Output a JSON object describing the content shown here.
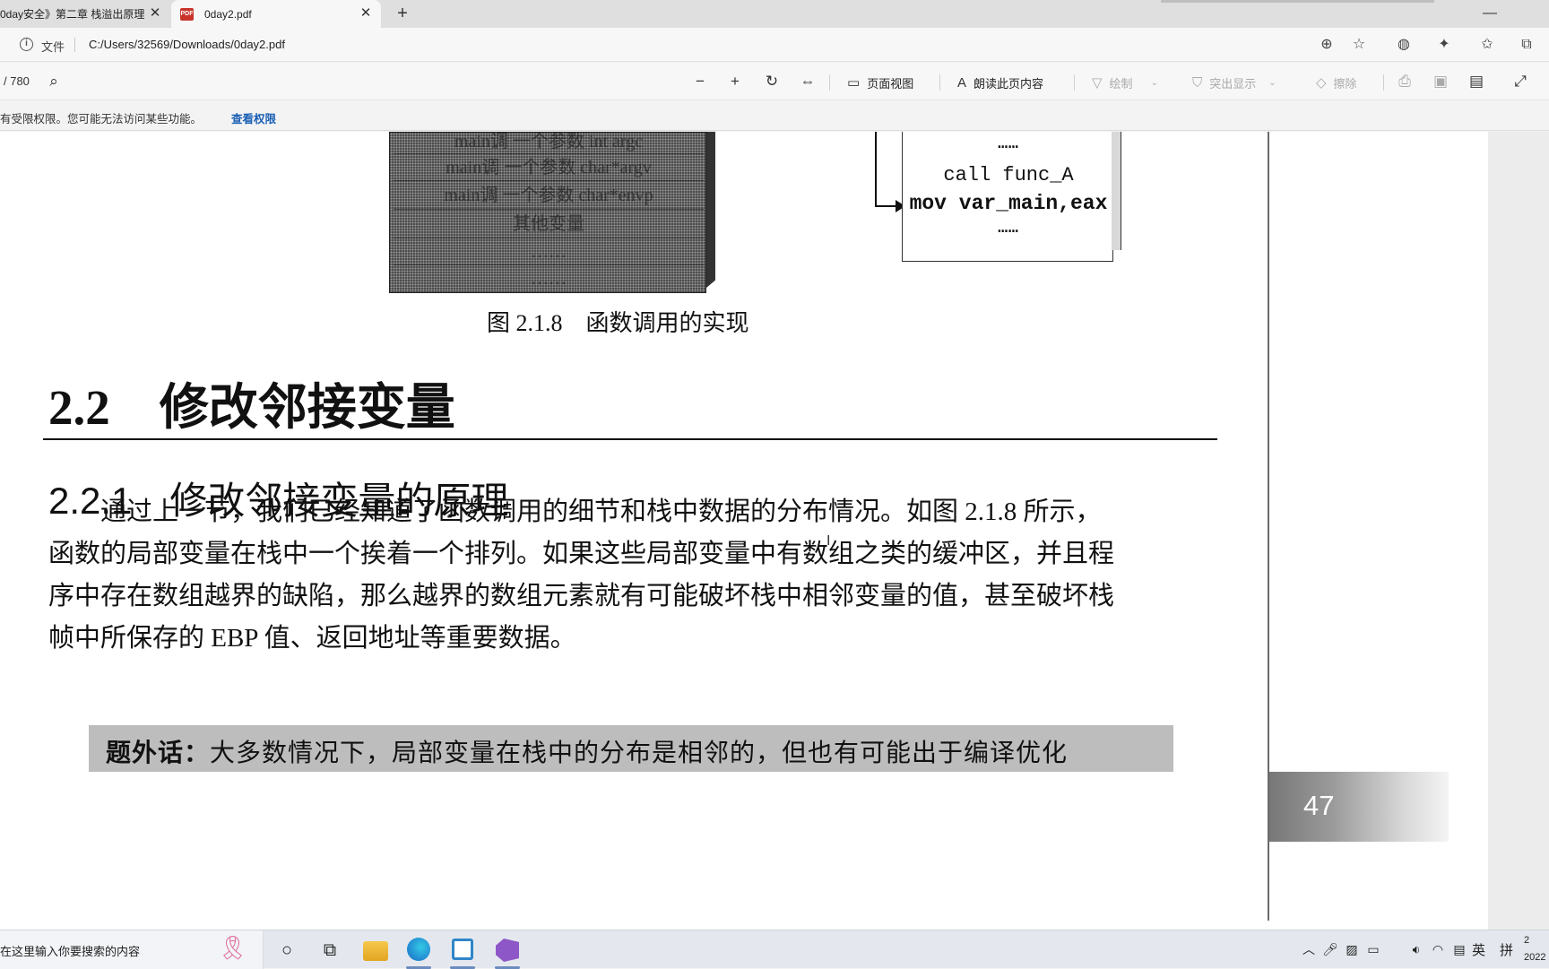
{
  "browser": {
    "tabs": [
      {
        "title": "0day安全》第二章 栈溢出原理"
      },
      {
        "title": "0day2.pdf"
      }
    ],
    "new_tab_glyph": "+",
    "close_glyph": "✕",
    "window_controls": {
      "minimize": "—"
    },
    "address": {
      "file_label": "文件",
      "url": "C:/Users/32569/Downloads/0day2.pdf"
    }
  },
  "pdf_toolbar": {
    "page_count": "/ 780",
    "page_view": "页面视图",
    "read_aloud": "朗读此页内容",
    "draw": "绘制",
    "highlight": "突出显示",
    "erase": "擦除"
  },
  "notice": {
    "text": "有受限权限。您可能无法访问某些功能。",
    "link": "查看权限"
  },
  "document": {
    "figure": {
      "stack_rows": [
        "main调 一个参数 int argc",
        "main调 一个参数 char*argv",
        "main调 一个参数 char*envp",
        "其他变量",
        "……",
        "……"
      ],
      "code_lines": [
        "……",
        "call func_A",
        "mov var_main,eax",
        "……"
      ],
      "caption": "图 2.1.8　函数调用的实现"
    },
    "section_title": "2.2　修改邻接变量",
    "subsection_title": "2.2.1　修改邻接变量的原理",
    "paragraph_lines": [
      "　　通过上一节，我们已经知道了函数调用的细节和栈中数据的分布情况。如图 2.1.8 所示，",
      "函数的局部变量在栈中一个挨着一个排列。如果这些局部变量中有数组之类的缓冲区，并且程",
      "序中存在数组越界的缺陷，那么越界的数组元素就有可能破坏栈中相邻变量的值，甚至破坏栈",
      "帧中所保存的 EBP 值、返回地址等重要数据。"
    ],
    "aside_label": "题外话：",
    "aside_text": "大多数情况下，局部变量在栈中的分布是相邻的，但也有可能出于编译优化",
    "page_number": "47"
  },
  "taskbar": {
    "search_text": "在这里输入你要搜索的内容",
    "ime_lang": "英",
    "ime_mode": "拼",
    "clock_time": "2",
    "clock_date": "2022"
  },
  "colors": {
    "link": "#1a5fb4",
    "aside_bg": "#bdbdbd",
    "pdf_badge": "#c8332a"
  }
}
